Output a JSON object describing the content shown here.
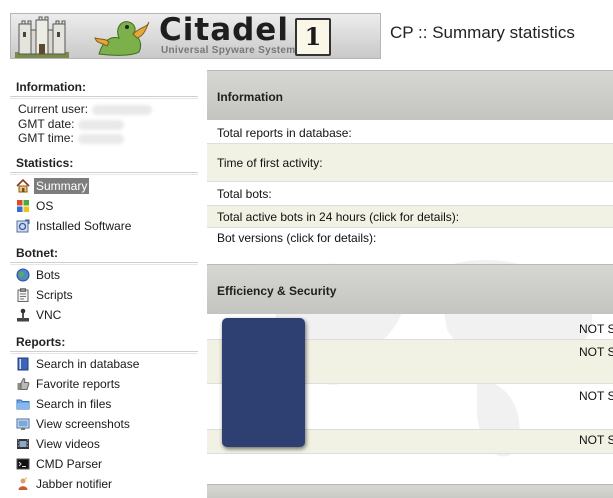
{
  "header": {
    "brand": "Citadel",
    "brand_number": "1",
    "brand_subtitle": "Universal Spyware System",
    "page_title": "CP :: Summary statistics"
  },
  "sidebar": {
    "information": {
      "title": "Information:",
      "current_user_label": "Current user:",
      "gmt_date_label": "GMT date:",
      "gmt_time_label": "GMT time:"
    },
    "statistics": {
      "title": "Statistics:",
      "items": [
        {
          "label": "Summary",
          "icon": "house-icon",
          "active": true
        },
        {
          "label": "OS",
          "icon": "windows-icon"
        },
        {
          "label": "Installed Software",
          "icon": "software-icon"
        }
      ]
    },
    "botnet": {
      "title": "Botnet:",
      "items": [
        {
          "label": "Bots",
          "icon": "globe-icon"
        },
        {
          "label": "Scripts",
          "icon": "clipboard-icon"
        },
        {
          "label": "VNC",
          "icon": "joystick-icon"
        }
      ]
    },
    "reports": {
      "title": "Reports:",
      "items": [
        {
          "label": "Search in database",
          "icon": "book-icon"
        },
        {
          "label": "Favorite reports",
          "icon": "thumbs-up-icon"
        },
        {
          "label": "Search in files",
          "icon": "folder-icon"
        },
        {
          "label": "View screenshots",
          "icon": "screenshot-icon"
        },
        {
          "label": "View videos",
          "icon": "film-icon"
        },
        {
          "label": "CMD Parser",
          "icon": "terminal-icon"
        },
        {
          "label": "Jabber notifier",
          "icon": "jabber-icon"
        }
      ]
    }
  },
  "main": {
    "information": {
      "title": "Information",
      "rows": [
        {
          "label": "Total reports in database:"
        },
        {
          "label": "Time of first activity:"
        },
        {
          "label": "Total bots:"
        },
        {
          "label": "Total active bots in 24 hours (click for details):"
        },
        {
          "label": "Bot versions (click for details):"
        }
      ]
    },
    "efficiency": {
      "title": "Efficiency & Security",
      "statuses": [
        "NOT S",
        "NOT S",
        "NOT S",
        "NOT S"
      ]
    }
  },
  "colors": {
    "section_band": "#cfcfcb",
    "alt_row": "#f1f1e4",
    "active_nav": "#7d7d7d",
    "redaction": "#2e3f72"
  }
}
